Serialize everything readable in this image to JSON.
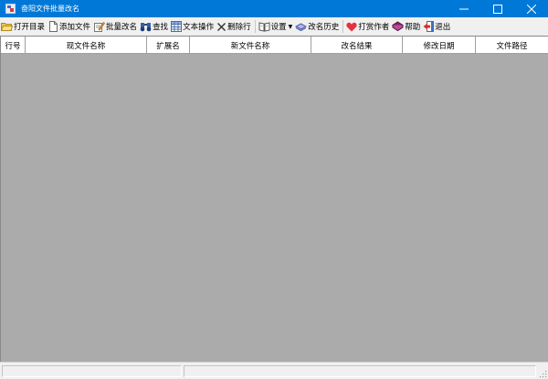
{
  "window": {
    "title": "奋阳文件批量改名",
    "minimize_icon": "minimize-icon",
    "maximize_icon": "maximize-icon",
    "close_icon": "close-icon"
  },
  "toolbar": {
    "items": [
      {
        "label": "打开目录",
        "icon": "folder-open-icon"
      },
      {
        "label": "添加文件",
        "icon": "add-file-icon"
      },
      {
        "label": "批量改名",
        "icon": "pencil-icon"
      },
      {
        "label": "查找",
        "icon": "binoculars-icon"
      },
      {
        "label": "文本操作",
        "icon": "grid-icon"
      },
      {
        "label": "删除行",
        "icon": "delete-x-icon"
      },
      {
        "label": "设置",
        "icon": "settings-book-icon"
      },
      {
        "label": "改名历史",
        "icon": "history-icon"
      },
      {
        "label": "打赏作者",
        "icon": "heart-icon"
      },
      {
        "label": "帮助",
        "icon": "help-book-icon"
      },
      {
        "label": "退出",
        "icon": "exit-door-icon"
      }
    ]
  },
  "table": {
    "columns": [
      "行号",
      "现文件名称",
      "扩展名",
      "新文件名称",
      "改名结果",
      "修改日期",
      "文件路径"
    ],
    "rows": []
  },
  "colors": {
    "titlebar": "#0078d7",
    "grid_background": "#ababab",
    "header_background": "#ffffff",
    "chrome": "#f0f0f0"
  }
}
